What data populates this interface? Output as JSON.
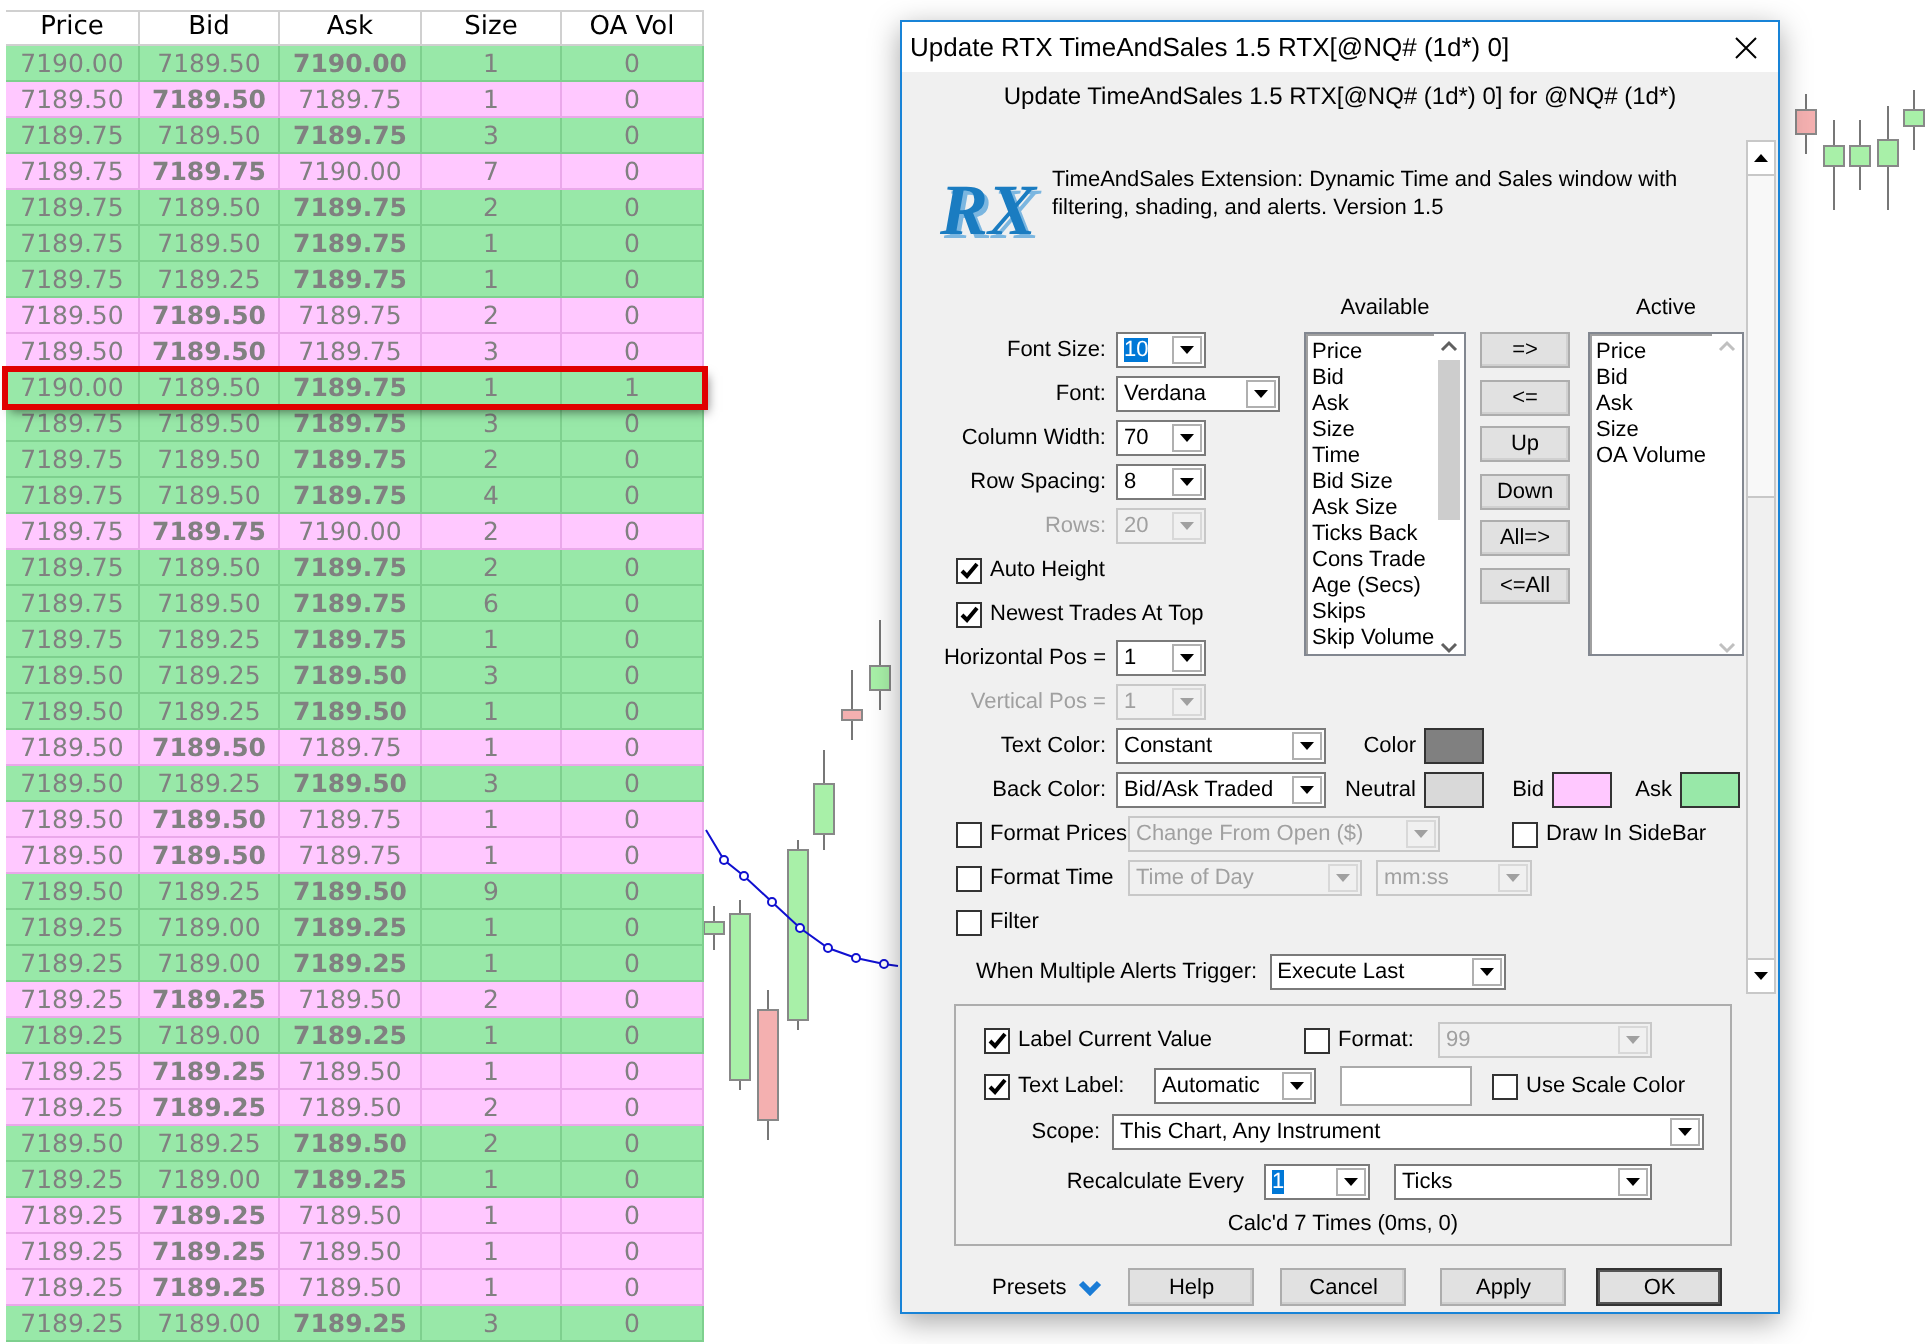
{
  "time_and_sales": {
    "columns": [
      "Price",
      "Bid",
      "Ask",
      "Size",
      "OA Vol"
    ],
    "rows": [
      {
        "cells": [
          "7190.00",
          "7189.50",
          "7190.00",
          "1",
          "0"
        ],
        "kind": "ask",
        "highlighted": false
      },
      {
        "cells": [
          "7189.50",
          "7189.50",
          "7189.75",
          "1",
          "0"
        ],
        "kind": "bid",
        "highlighted": false
      },
      {
        "cells": [
          "7189.75",
          "7189.50",
          "7189.75",
          "3",
          "0"
        ],
        "kind": "ask",
        "highlighted": false
      },
      {
        "cells": [
          "7189.75",
          "7189.75",
          "7190.00",
          "7",
          "0"
        ],
        "kind": "bid",
        "highlighted": false
      },
      {
        "cells": [
          "7189.75",
          "7189.50",
          "7189.75",
          "2",
          "0"
        ],
        "kind": "ask",
        "highlighted": false
      },
      {
        "cells": [
          "7189.75",
          "7189.50",
          "7189.75",
          "1",
          "0"
        ],
        "kind": "ask",
        "highlighted": false
      },
      {
        "cells": [
          "7189.75",
          "7189.25",
          "7189.75",
          "1",
          "0"
        ],
        "kind": "ask",
        "highlighted": false
      },
      {
        "cells": [
          "7189.50",
          "7189.50",
          "7189.75",
          "2",
          "0"
        ],
        "kind": "bid",
        "highlighted": false
      },
      {
        "cells": [
          "7189.50",
          "7189.50",
          "7189.75",
          "3",
          "0"
        ],
        "kind": "bid",
        "highlighted": false
      },
      {
        "cells": [
          "7190.00",
          "7189.50",
          "7189.75",
          "1",
          "1"
        ],
        "kind": "ask",
        "highlighted": true
      },
      {
        "cells": [
          "7189.75",
          "7189.50",
          "7189.75",
          "3",
          "0"
        ],
        "kind": "ask",
        "highlighted": false
      },
      {
        "cells": [
          "7189.75",
          "7189.50",
          "7189.75",
          "2",
          "0"
        ],
        "kind": "ask",
        "highlighted": false
      },
      {
        "cells": [
          "7189.75",
          "7189.50",
          "7189.75",
          "4",
          "0"
        ],
        "kind": "ask",
        "highlighted": false
      },
      {
        "cells": [
          "7189.75",
          "7189.75",
          "7190.00",
          "2",
          "0"
        ],
        "kind": "bid",
        "highlighted": false
      },
      {
        "cells": [
          "7189.75",
          "7189.50",
          "7189.75",
          "2",
          "0"
        ],
        "kind": "ask",
        "highlighted": false
      },
      {
        "cells": [
          "7189.75",
          "7189.50",
          "7189.75",
          "6",
          "0"
        ],
        "kind": "ask",
        "highlighted": false
      },
      {
        "cells": [
          "7189.75",
          "7189.25",
          "7189.75",
          "1",
          "0"
        ],
        "kind": "ask",
        "highlighted": false
      },
      {
        "cells": [
          "7189.50",
          "7189.25",
          "7189.50",
          "3",
          "0"
        ],
        "kind": "ask",
        "highlighted": false
      },
      {
        "cells": [
          "7189.50",
          "7189.25",
          "7189.50",
          "1",
          "0"
        ],
        "kind": "ask",
        "highlighted": false
      },
      {
        "cells": [
          "7189.50",
          "7189.50",
          "7189.75",
          "1",
          "0"
        ],
        "kind": "bid",
        "highlighted": false
      },
      {
        "cells": [
          "7189.50",
          "7189.25",
          "7189.50",
          "3",
          "0"
        ],
        "kind": "ask",
        "highlighted": false
      },
      {
        "cells": [
          "7189.50",
          "7189.50",
          "7189.75",
          "1",
          "0"
        ],
        "kind": "bid",
        "highlighted": false
      },
      {
        "cells": [
          "7189.50",
          "7189.50",
          "7189.75",
          "1",
          "0"
        ],
        "kind": "bid",
        "highlighted": false
      },
      {
        "cells": [
          "7189.50",
          "7189.25",
          "7189.50",
          "9",
          "0"
        ],
        "kind": "ask",
        "highlighted": false
      },
      {
        "cells": [
          "7189.25",
          "7189.00",
          "7189.25",
          "1",
          "0"
        ],
        "kind": "ask",
        "highlighted": false
      },
      {
        "cells": [
          "7189.25",
          "7189.00",
          "7189.25",
          "1",
          "0"
        ],
        "kind": "ask",
        "highlighted": false
      },
      {
        "cells": [
          "7189.25",
          "7189.25",
          "7189.50",
          "2",
          "0"
        ],
        "kind": "bid",
        "highlighted": false
      },
      {
        "cells": [
          "7189.25",
          "7189.00",
          "7189.25",
          "1",
          "0"
        ],
        "kind": "ask",
        "highlighted": false
      },
      {
        "cells": [
          "7189.25",
          "7189.25",
          "7189.50",
          "1",
          "0"
        ],
        "kind": "bid",
        "highlighted": false
      },
      {
        "cells": [
          "7189.25",
          "7189.25",
          "7189.50",
          "2",
          "0"
        ],
        "kind": "bid",
        "highlighted": false
      },
      {
        "cells": [
          "7189.50",
          "7189.25",
          "7189.50",
          "2",
          "0"
        ],
        "kind": "ask",
        "highlighted": false
      },
      {
        "cells": [
          "7189.25",
          "7189.00",
          "7189.25",
          "1",
          "0"
        ],
        "kind": "ask",
        "highlighted": false
      },
      {
        "cells": [
          "7189.25",
          "7189.25",
          "7189.50",
          "1",
          "0"
        ],
        "kind": "bid",
        "highlighted": false
      },
      {
        "cells": [
          "7189.25",
          "7189.25",
          "7189.50",
          "1",
          "0"
        ],
        "kind": "bid",
        "highlighted": false
      },
      {
        "cells": [
          "7189.25",
          "7189.25",
          "7189.50",
          "1",
          "0"
        ],
        "kind": "bid",
        "highlighted": false
      },
      {
        "cells": [
          "7189.25",
          "7189.00",
          "7189.25",
          "3",
          "0"
        ],
        "kind": "ask",
        "highlighted": false
      }
    ]
  },
  "dialog": {
    "title": "Update RTX TimeAndSales 1.5 RTX[@NQ# (1d*) 0]",
    "subtitle": "Update TimeAndSales 1.5 RTX[@NQ# (1d*) 0] for @NQ# (1d*)",
    "logo": "RX",
    "description": "TimeAndSales Extension: Dynamic Time and Sales window with filtering, shading, and alerts. Version 1.5",
    "settings": [
      {
        "kind": "combo",
        "label": "Font Size:",
        "value": "10",
        "disabled": false,
        "highlighted": true
      },
      {
        "kind": "combo",
        "label": "Font:",
        "value": "Verdana",
        "disabled": false,
        "highlighted": false
      },
      {
        "kind": "combo",
        "label": "Column Width:",
        "value": "70",
        "disabled": false,
        "highlighted": false
      },
      {
        "kind": "combo",
        "label": "Row Spacing:",
        "value": "8",
        "disabled": false,
        "highlighted": false
      },
      {
        "kind": "combo",
        "label": "Rows:",
        "value": "20",
        "disabled": true,
        "highlighted": false
      },
      {
        "kind": "check",
        "label": "Auto Height",
        "checked": true
      },
      {
        "kind": "check",
        "label": "Newest Trades At Top",
        "checked": true
      },
      {
        "kind": "combo",
        "label": "Horizontal Pos =",
        "value": "1",
        "disabled": false,
        "highlighted": false
      },
      {
        "kind": "combo",
        "label": "Vertical Pos =",
        "value": "1",
        "disabled": true,
        "highlighted": false
      }
    ],
    "available": {
      "heading": "Available",
      "items": [
        "Price",
        "Bid",
        "Ask",
        "Size",
        "Time",
        "Bid Size",
        "Ask Size",
        "Ticks Back",
        "Cons Trade",
        "Age (Secs)",
        "Skips",
        "Skip Volume"
      ]
    },
    "active": {
      "heading": "Active",
      "items": [
        "Price",
        "Bid",
        "Ask",
        "Size",
        "OA Volume"
      ]
    },
    "move_buttons": [
      "=>",
      "<=",
      "Up",
      "Down",
      "All=>",
      "<=All"
    ],
    "text_color": {
      "label": "Text Color:",
      "value": "Constant",
      "swatches": [
        {
          "label": "Color",
          "color": "#808080"
        }
      ]
    },
    "back_color": {
      "label": "Back Color:",
      "value": "Bid/Ask Traded",
      "swatches": [
        {
          "label": "Neutral",
          "color": "#d9d9d9"
        },
        {
          "label": "Bid",
          "color": "#ffc8ff"
        },
        {
          "label": "Ask",
          "color": "#98e8a8"
        }
      ]
    },
    "format_prices": {
      "label": "Format Prices",
      "checked": false,
      "value": "Change From Open ($)"
    },
    "draw_in_sidebar": {
      "label": "Draw In SideBar",
      "checked": false
    },
    "format_time": {
      "label": "Format Time",
      "checked": false,
      "values": [
        "Time of Day",
        "mm:ss"
      ]
    },
    "filter": {
      "label": "Filter",
      "checked": false
    },
    "alerts_trigger": {
      "label": "When Multiple Alerts Trigger:",
      "value": "Execute Last"
    },
    "label_current_value": {
      "label": "Label Current Value",
      "checked": true
    },
    "format": {
      "label": "Format:",
      "checked": false,
      "value": "99"
    },
    "text_label": {
      "label": "Text Label:",
      "checked": true,
      "value": "Automatic"
    },
    "use_scale_color": {
      "label": "Use Scale Color",
      "checked": false
    },
    "scope": {
      "label": "Scope:",
      "value": "This Chart, Any Instrument"
    },
    "recalculate": {
      "label": "Recalculate Every",
      "value": "1",
      "highlighted": true,
      "unit": "Ticks"
    },
    "calc_status": "Calc'd 7 Times (0ms, 0)",
    "presets": "Presets",
    "buttons": [
      {
        "label": "Help",
        "default": false
      },
      {
        "label": "Cancel",
        "default": false
      },
      {
        "label": "Apply",
        "default": false
      },
      {
        "label": "OK",
        "default": true
      }
    ]
  }
}
